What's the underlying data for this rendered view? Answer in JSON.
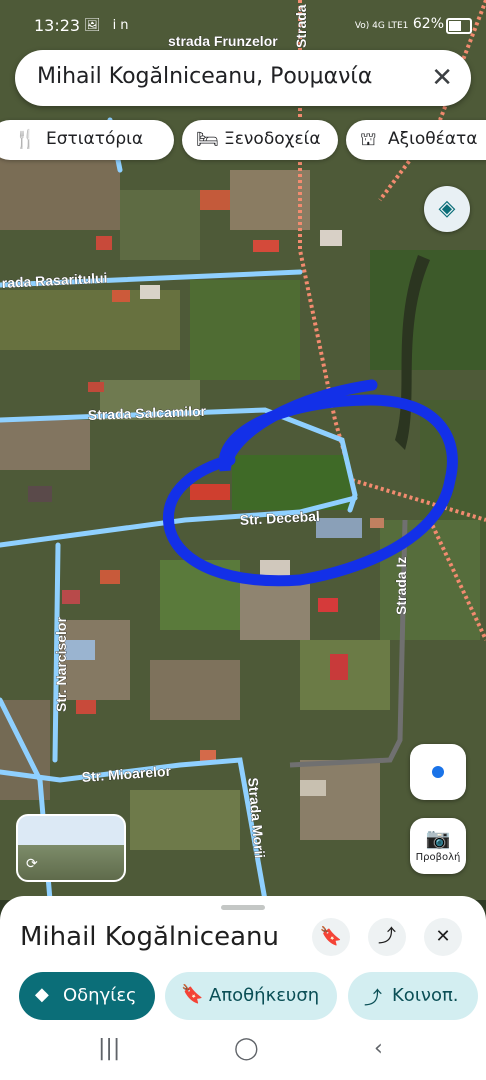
{
  "status_bar": {
    "time": "13:23",
    "battery": "62%",
    "network": "Vo) 4G LTE1"
  },
  "search": {
    "query": "Mihail Kogălniceanu, Ρουμανία"
  },
  "chips": [
    {
      "icon": "restaurant-icon",
      "label": "Εστιατόρια"
    },
    {
      "icon": "hotel-icon",
      "label": "Ξενοδοχεία"
    },
    {
      "icon": "attractions-icon",
      "label": "Αξιοθέατα"
    }
  ],
  "map": {
    "streets": [
      "strada Frunzelor",
      "Strada Izvorului",
      "rada Rasaritului",
      "Strada Salcamilor",
      "Str. Decebal",
      "Strada Iz",
      "Str. Narciselor",
      "Str. Mioarelor",
      "Strada Morii"
    ]
  },
  "lens": {
    "label": "Προβολή"
  },
  "place": {
    "title": "Mihail Kogălniceanu"
  },
  "actions": [
    {
      "icon": "directions-icon",
      "label": "Οδηγίες"
    },
    {
      "icon": "bookmark-icon",
      "label": "Αποθήκευση"
    },
    {
      "icon": "share-icon",
      "label": "Κοινοπ."
    }
  ],
  "colors": {
    "accent": "#0b6e78",
    "accent_light": "#d3eef1",
    "route_blue": "#1a8fd6",
    "annotation": "#1330e8"
  }
}
